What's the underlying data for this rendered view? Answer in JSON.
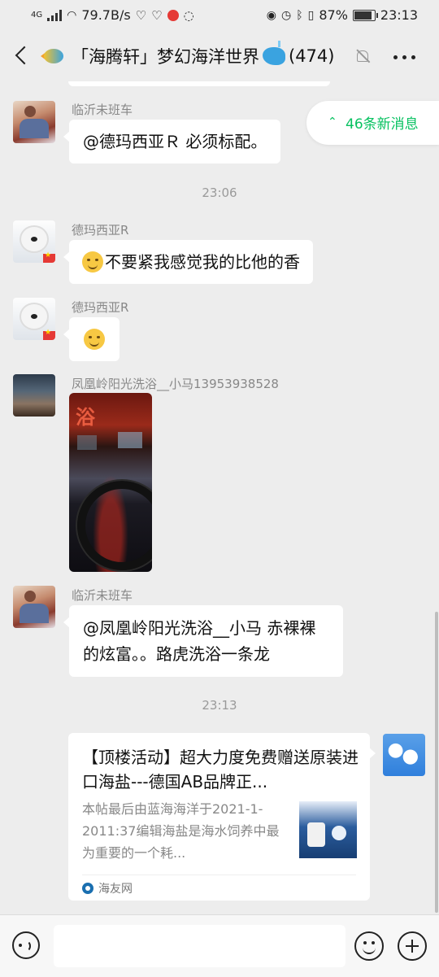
{
  "status_bar": {
    "network": "4G",
    "speed": "79.7B/s",
    "battery": "87%",
    "time": "23:13"
  },
  "header": {
    "title": "「海腾轩」梦幻海洋世界",
    "member_count": "(474)"
  },
  "new_messages": {
    "arrow": "⌃",
    "label": "46条新消息"
  },
  "messages": [
    {
      "sender": "临沂未班车",
      "text": "@德玛西亚Ｒ 必须标配。"
    },
    {
      "time": "23:06"
    },
    {
      "sender": "德玛西亚R",
      "text": "不要紧我感觉我的比他的香"
    },
    {
      "sender": "德玛西亚R"
    },
    {
      "sender": "凤凰岭阳光洗浴__小马13953938528",
      "photo_sign": "浴"
    },
    {
      "sender": "临沂未班车",
      "line1": "@凤凰岭阳光洗浴__小马   赤裸裸",
      "line2": "的炫富。。路虎洗浴一条龙"
    },
    {
      "time": "23:13"
    }
  ],
  "share_card": {
    "title": "【顶楼活动】超大力度免费赠送原装进口海盐---德国AB品牌正...",
    "description": "本帖最后由蓝海海洋于2021-1-2011:37编辑海盐是海水饲养中最为重要的一个耗...",
    "source": "海友网"
  },
  "input_bar": {
    "placeholder": ""
  }
}
